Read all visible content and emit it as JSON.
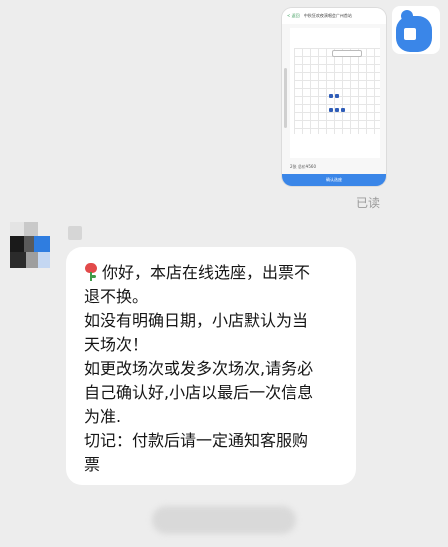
{
  "screenshot_preview": {
    "header_back": "< 返回",
    "header_title": "中秋狂欢夜演唱会广州首站",
    "bottom_info": "2张  总价¥560",
    "bottom_button": "确认选座"
  },
  "read_status": "已读",
  "message": {
    "lines": [
      "你好，本店在线选座，出票不",
      "退不换。",
      "如没有明确日期，小店默认为当",
      "天场次！",
      "如更改场次或发多次场次,请务必",
      "自己确认好,小店以最后一次信息",
      "为准.",
      "切记：付款后请一定通知客服购",
      "票"
    ],
    "leading_icon": "rose-icon"
  },
  "colors": {
    "background": "#ededed",
    "bubble": "#ffffff",
    "accent_blue": "#3a86e8",
    "read_text": "#9a9a9a"
  }
}
